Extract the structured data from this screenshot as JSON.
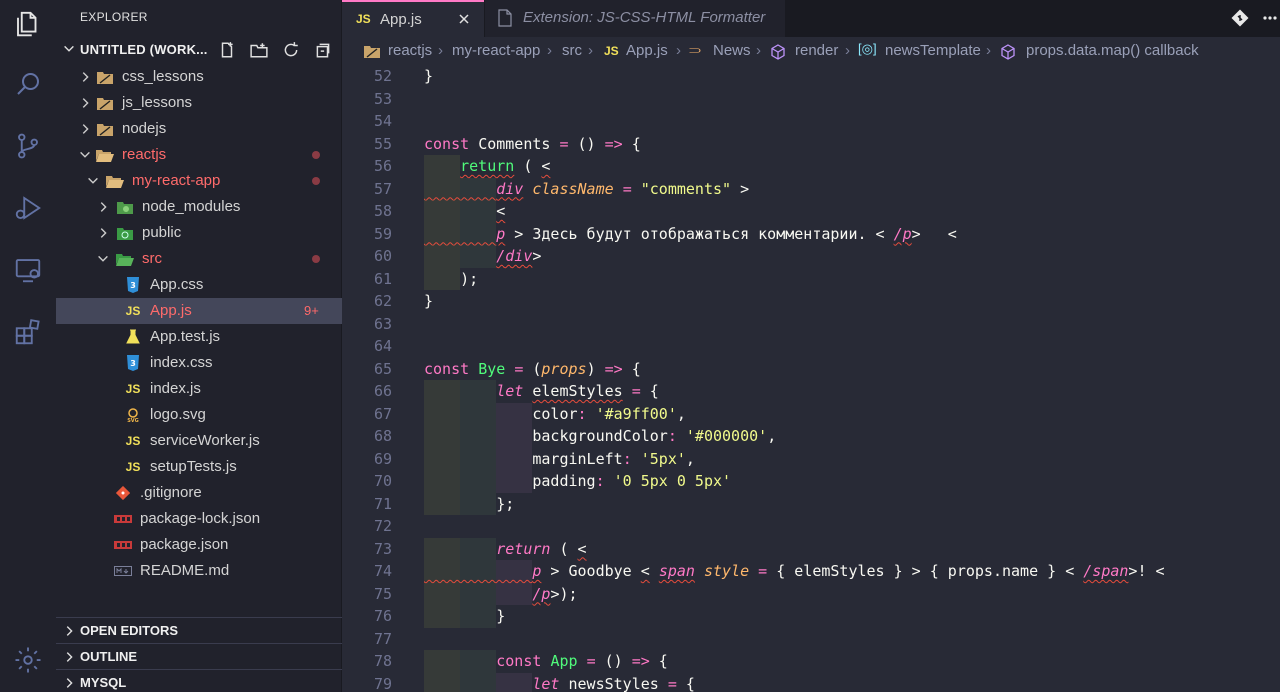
{
  "activity": {
    "items": [
      {
        "name": "explorer-icon"
      },
      {
        "name": "search-icon"
      },
      {
        "name": "source-control-icon"
      },
      {
        "name": "run-debug-icon"
      },
      {
        "name": "remote-explorer-icon"
      },
      {
        "name": "extensions-icon"
      },
      {
        "name": "settings-gear-icon"
      }
    ]
  },
  "sidebar": {
    "title": "EXPLORER",
    "workspace": "UNTITLED (WORK...",
    "tree": [
      {
        "label": "css_lessons",
        "depth": 0,
        "kind": "folder"
      },
      {
        "label": "js_lessons",
        "depth": 0,
        "kind": "folder"
      },
      {
        "label": "nodejs",
        "depth": 0,
        "kind": "folder"
      },
      {
        "label": "reactjs",
        "depth": 0,
        "kind": "folder-open"
      },
      {
        "label": "my-react-app",
        "depth": 1,
        "kind": "folder-open"
      },
      {
        "label": "node_modules",
        "depth": 2,
        "kind": "folder"
      },
      {
        "label": "public",
        "depth": 2,
        "kind": "folder"
      },
      {
        "label": "src",
        "depth": 2,
        "kind": "folder-open"
      },
      {
        "label": "App.css",
        "depth": 3,
        "kind": "css"
      },
      {
        "label": "App.js",
        "depth": 3,
        "kind": "js",
        "badge": "9+"
      },
      {
        "label": "App.test.js",
        "depth": 3,
        "kind": "test"
      },
      {
        "label": "index.css",
        "depth": 3,
        "kind": "css"
      },
      {
        "label": "index.js",
        "depth": 3,
        "kind": "js"
      },
      {
        "label": "logo.svg",
        "depth": 3,
        "kind": "svg"
      },
      {
        "label": "serviceWorker.js",
        "depth": 3,
        "kind": "js"
      },
      {
        "label": "setupTests.js",
        "depth": 3,
        "kind": "js"
      },
      {
        "label": ".gitignore",
        "depth": 2,
        "kind": "git"
      },
      {
        "label": "package-lock.json",
        "depth": 2,
        "kind": "npm"
      },
      {
        "label": "package.json",
        "depth": 2,
        "kind": "npm"
      },
      {
        "label": "README.md",
        "depth": 2,
        "kind": "md"
      }
    ],
    "sections": [
      "OPEN EDITORS",
      "OUTLINE",
      "MYSQL"
    ]
  },
  "tabs": {
    "active": {
      "icon": "JS",
      "label": "App.js"
    },
    "inactive": {
      "label": "Extension: JS-CSS-HTML Formatter"
    }
  },
  "breadcrumb": [
    "reactjs",
    "my-react-app",
    "src",
    "App.js",
    "News",
    "render",
    "newsTemplate",
    "props.data.map() callback"
  ],
  "editor": {
    "line_numbers": [
      "52",
      "53",
      "54",
      "55",
      "56",
      "57",
      "58",
      "59",
      "60",
      "61",
      "62",
      "63",
      "64",
      "65",
      "66",
      "67",
      "68",
      "69",
      "70",
      "71",
      "72",
      "73",
      "74",
      "75",
      "76",
      "77",
      "78",
      "79"
    ]
  },
  "colors": {
    "background": "#282a36",
    "sidebar": "#21222c",
    "accent": "#ff79c6",
    "string": "#f1fa8c",
    "function": "#50fa7b",
    "param": "#ffb86c",
    "error": "#ff6b6b"
  }
}
